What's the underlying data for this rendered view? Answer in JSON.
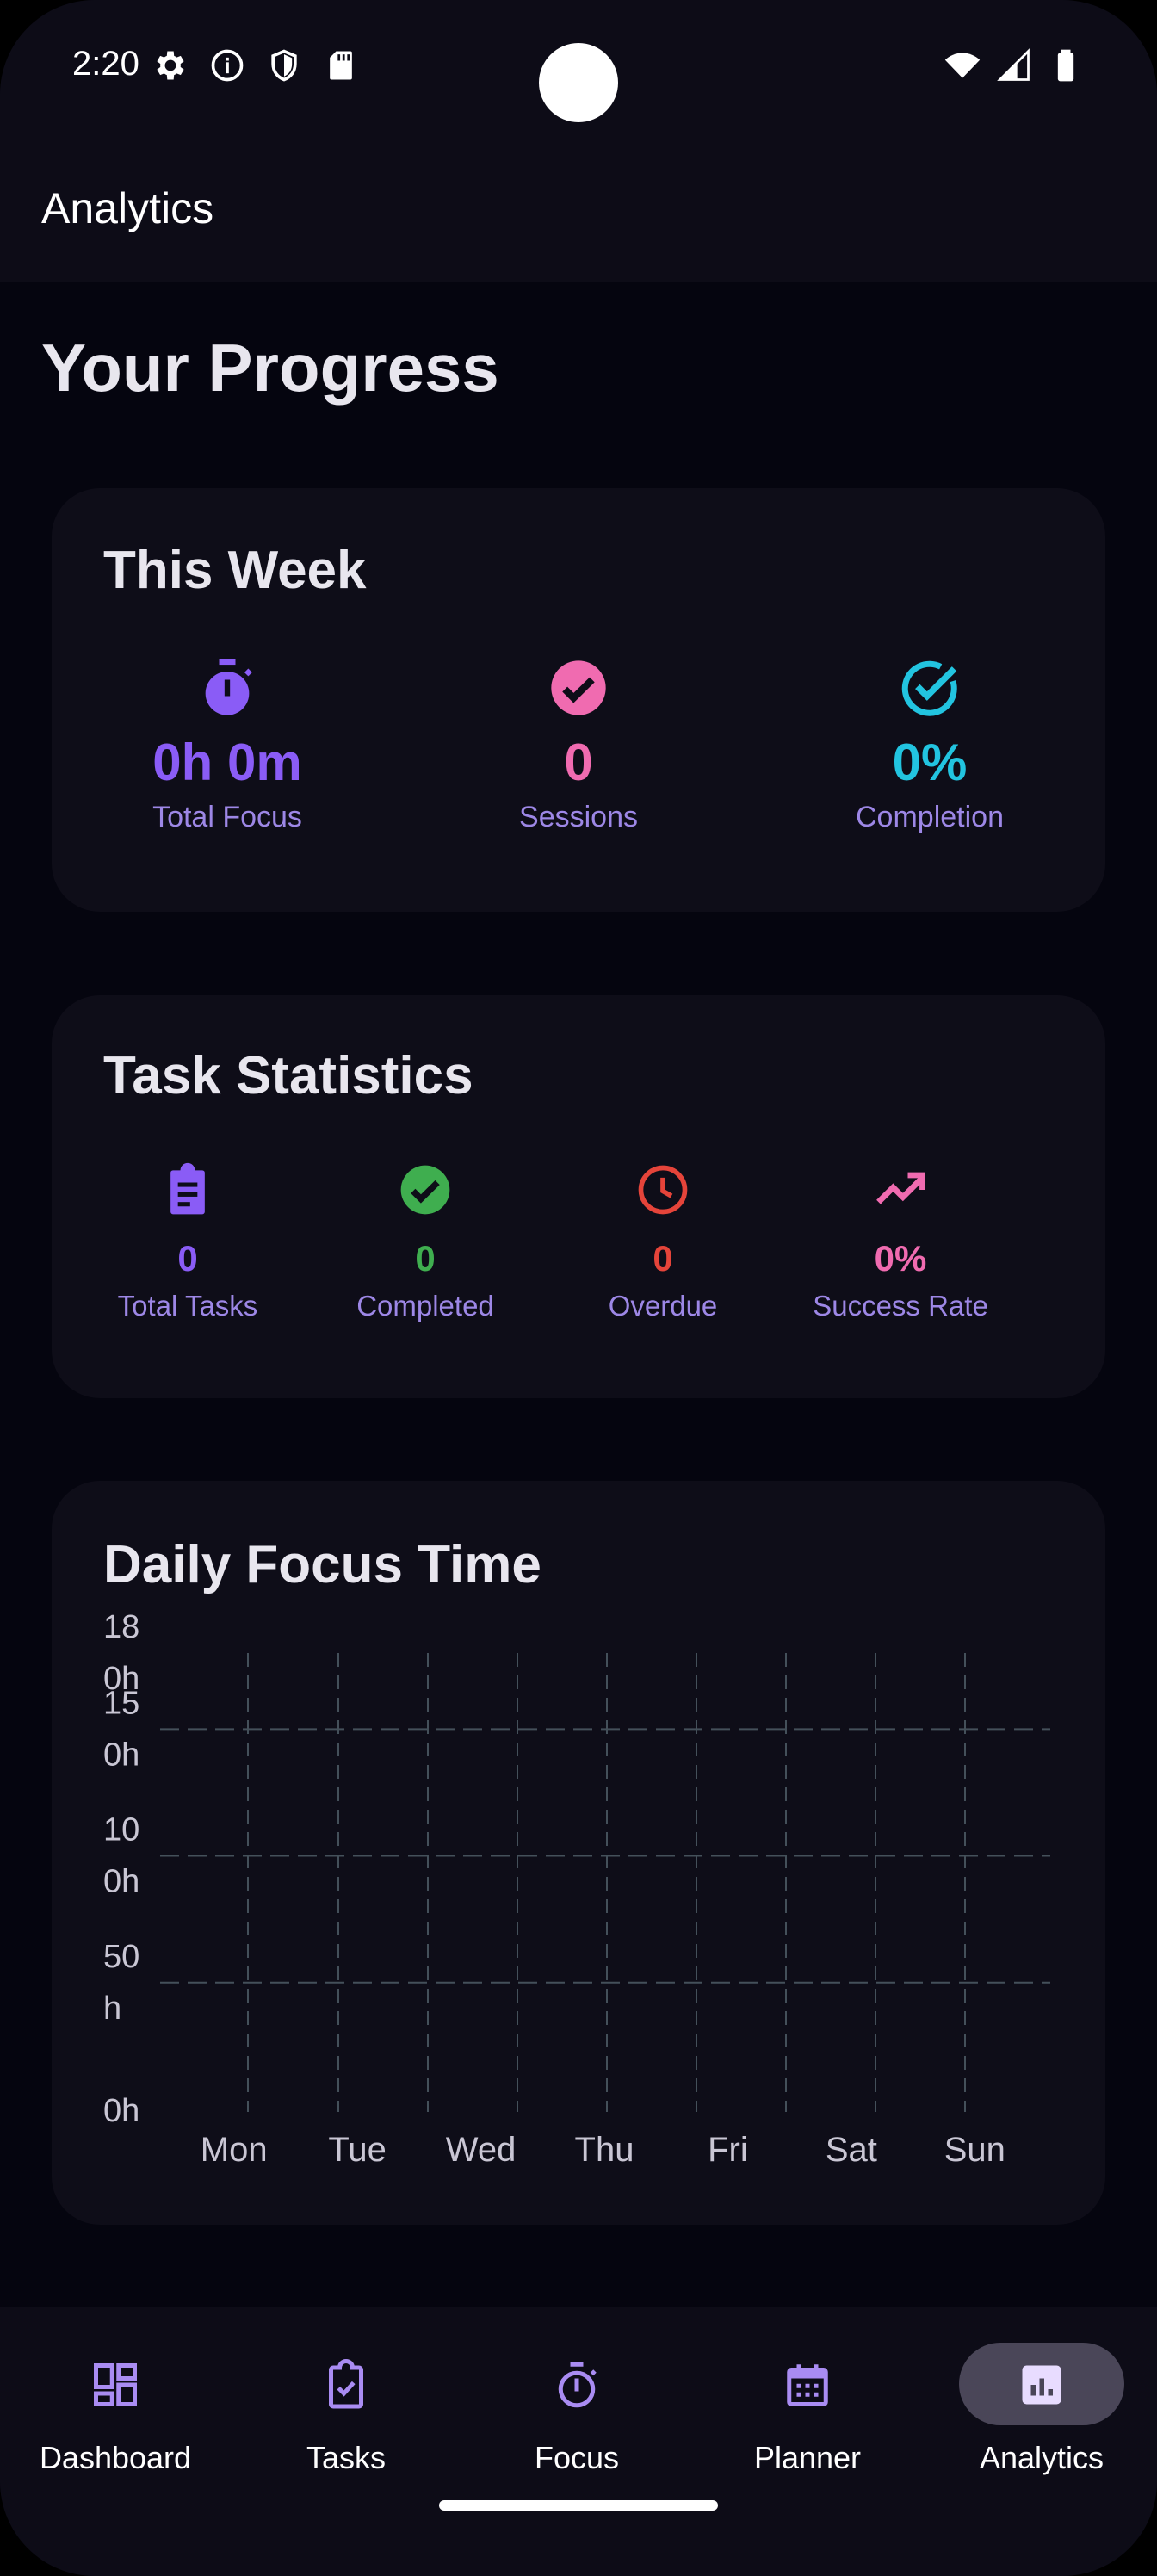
{
  "status_bar": {
    "time": "2:20"
  },
  "app_bar": {
    "title": "Analytics"
  },
  "page": {
    "heading": "Your Progress"
  },
  "this_week": {
    "title": "This Week",
    "stats": [
      {
        "value": "0h 0m",
        "label": "Total Focus",
        "icon": "stopwatch-icon",
        "color": "#8a5cf6"
      },
      {
        "value": "0",
        "label": "Sessions",
        "icon": "check-circle-icon",
        "color": "#f06bb0"
      },
      {
        "value": "0%",
        "label": "Completion",
        "icon": "check-circle-outline-icon",
        "color": "#22c4e0"
      }
    ]
  },
  "task_statistics": {
    "title": "Task Statistics",
    "stats": [
      {
        "value": "0",
        "label": "Total Tasks",
        "icon": "clipboard-icon",
        "color": "#8a5cf6"
      },
      {
        "value": "0",
        "label": "Completed",
        "icon": "check-circle-icon",
        "color": "#3fae4f"
      },
      {
        "value": "0",
        "label": "Overdue",
        "icon": "clock-icon",
        "color": "#e5443a"
      },
      {
        "value": "0%",
        "label": "Success Rate",
        "icon": "trending-up-icon",
        "color": "#f06bb0"
      }
    ]
  },
  "daily_focus": {
    "title": "Daily Focus Time"
  },
  "chart_data": {
    "type": "bar",
    "title": "Daily Focus Time",
    "categories": [
      "Mon",
      "Tue",
      "Wed",
      "Thu",
      "Fri",
      "Sat",
      "Sun"
    ],
    "values": [
      0,
      0,
      0,
      0,
      0,
      0,
      0
    ],
    "y_ticks": [
      "0h",
      "50 h",
      "10 0h",
      "15 0h",
      "18 0h"
    ],
    "ylim": [
      0,
      180
    ],
    "grid": true
  },
  "bottom_nav": {
    "items": [
      {
        "label": "Dashboard",
        "icon": "dashboard-icon",
        "active": false
      },
      {
        "label": "Tasks",
        "icon": "task-icon",
        "active": false
      },
      {
        "label": "Focus",
        "icon": "timer-icon",
        "active": false
      },
      {
        "label": "Planner",
        "icon": "calendar-icon",
        "active": false
      },
      {
        "label": "Analytics",
        "icon": "analytics-icon",
        "active": true
      }
    ]
  },
  "colors": {
    "background": "#05050f",
    "surface": "#0e0d18",
    "accent": "#8a5cf6",
    "label": "#9d87e6"
  }
}
